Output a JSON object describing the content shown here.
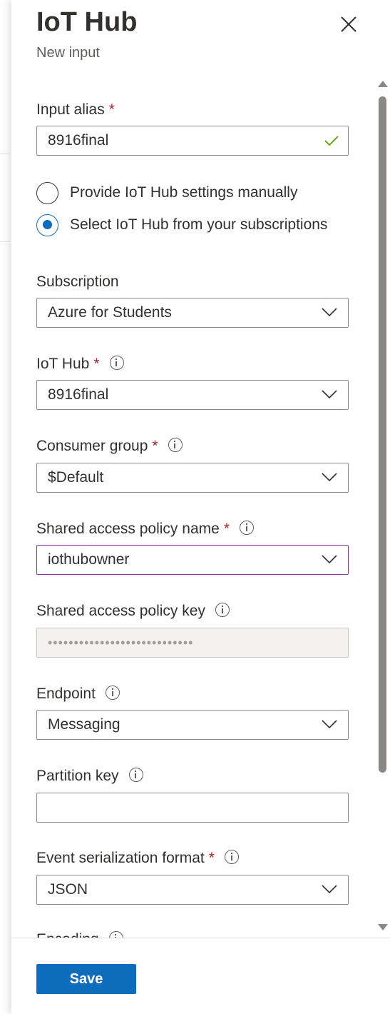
{
  "header": {
    "title": "IoT Hub",
    "subtitle": "New input"
  },
  "form": {
    "input_alias": {
      "label": "Input alias",
      "required": "*",
      "value": "8916final"
    },
    "source_options": [
      {
        "label": "Provide IoT Hub settings manually",
        "checked": false
      },
      {
        "label": "Select IoT Hub from your subscriptions",
        "checked": true
      }
    ],
    "subscription": {
      "label": "Subscription",
      "value": "Azure for Students"
    },
    "iot_hub": {
      "label": "IoT Hub",
      "required": "*",
      "value": "8916final"
    },
    "consumer_group": {
      "label": "Consumer group",
      "required": "*",
      "value": "$Default"
    },
    "shared_access_policy_name": {
      "label": "Shared access policy name",
      "required": "*",
      "value": "iothubowner"
    },
    "shared_access_policy_key": {
      "label": "Shared access policy key",
      "value": "••••••••••••••••••••••••••••"
    },
    "endpoint": {
      "label": "Endpoint",
      "value": "Messaging"
    },
    "partition_key": {
      "label": "Partition key",
      "value": ""
    },
    "event_serialization_format": {
      "label": "Event serialization format",
      "required": "*",
      "value": "JSON"
    },
    "encoding": {
      "label": "Encoding"
    }
  },
  "footer": {
    "save_label": "Save"
  },
  "colors": {
    "accent": "#0f6cbd",
    "required": "#a4262c",
    "valid": "#57a300",
    "focus_border": "#7a3a95"
  },
  "icons": [
    "close-icon",
    "checkmark-icon",
    "info-icon",
    "chevron-down-icon",
    "scroll-up-icon",
    "scroll-down-icon"
  ]
}
